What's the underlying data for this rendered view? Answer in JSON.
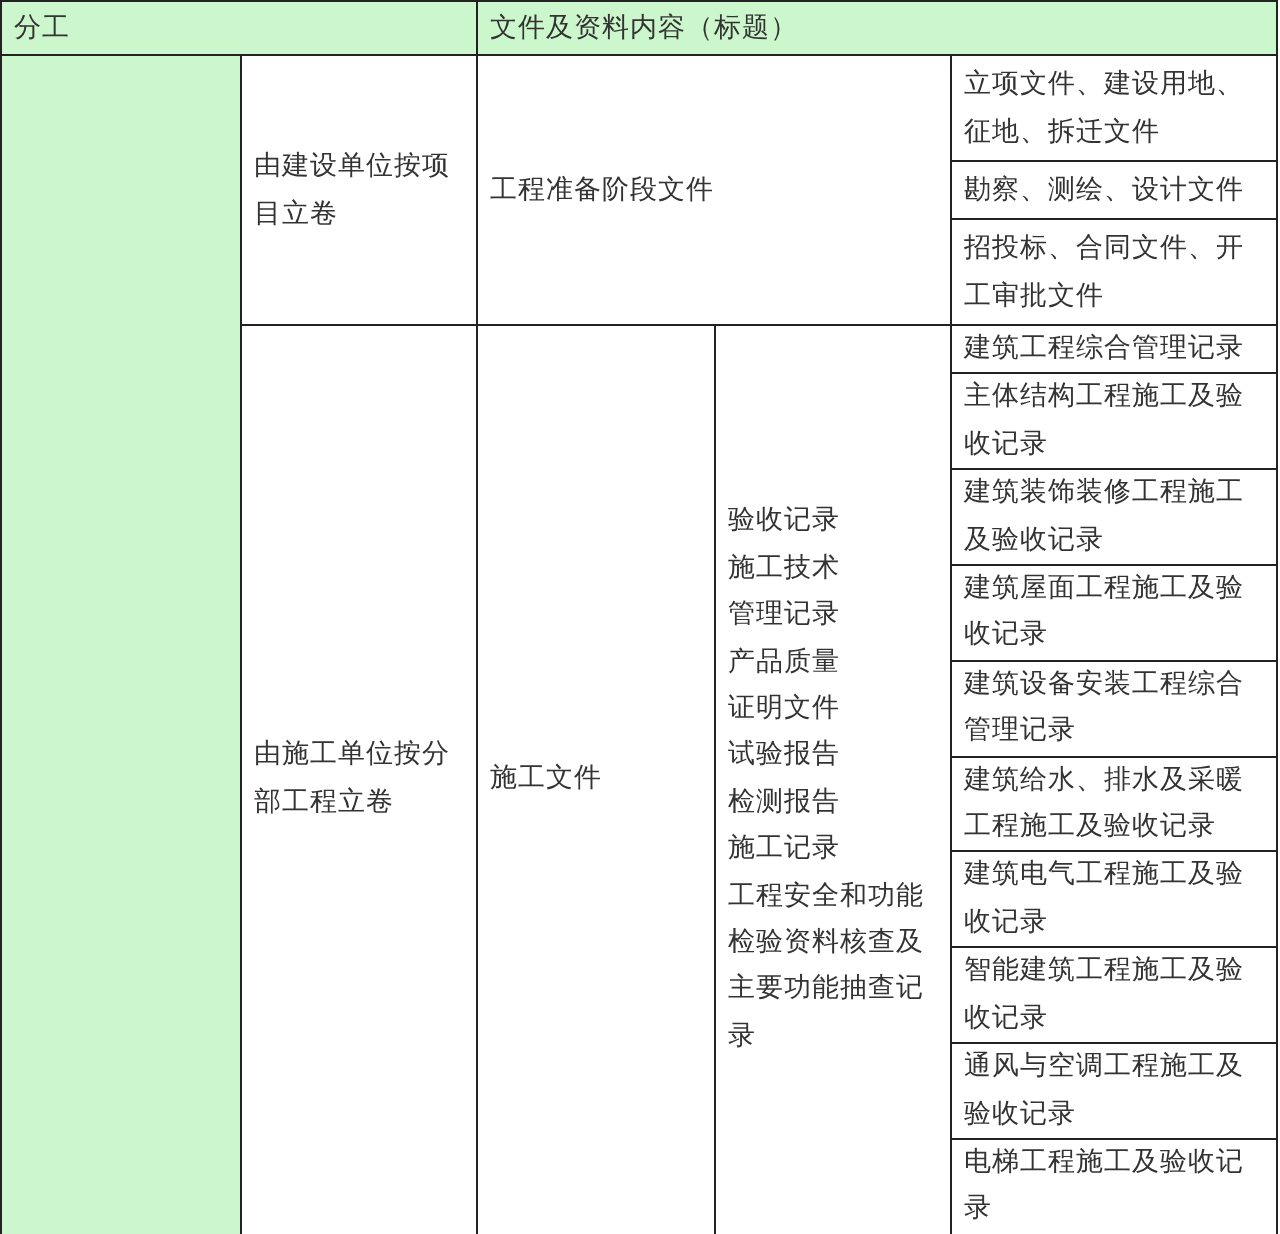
{
  "header": {
    "division": "分工",
    "contents": "文件及资料内容（标题）"
  },
  "groups": [
    {
      "archived_by": "由建设单位按项目立卷",
      "category": "工程准备阶段文件",
      "items": [
        "立项文件、建设用地、征地、拆迁文件",
        "勘察、测绘、设计文件",
        "招投标、合同文件、开工审批文件"
      ]
    },
    {
      "archived_by": "由施工单位按分部工程立卷",
      "category": "施工文件",
      "subcategories": [
        "验收记录",
        "施工技术",
        "管理记录",
        "产品质量",
        "证明文件",
        "试验报告",
        "检测报告",
        "施工记录",
        "工程安全和功能检验资料核查及主要功能抽查记录"
      ],
      "items": [
        "建筑工程综合管理记录",
        "主体结构工程施工及验收记录",
        "建筑装饰装修工程施工及验收记录",
        "建筑屋面工程施工及验收记录",
        "建筑设备安装工程综合管理记录",
        "建筑给水、排水及采暖工程施工及验收记录",
        "建筑电气工程施工及验收记录",
        "智能建筑工程施工及验收记录",
        "通风与空调工程施工及验收记录",
        "电梯工程施工及验收记录"
      ]
    }
  ]
}
